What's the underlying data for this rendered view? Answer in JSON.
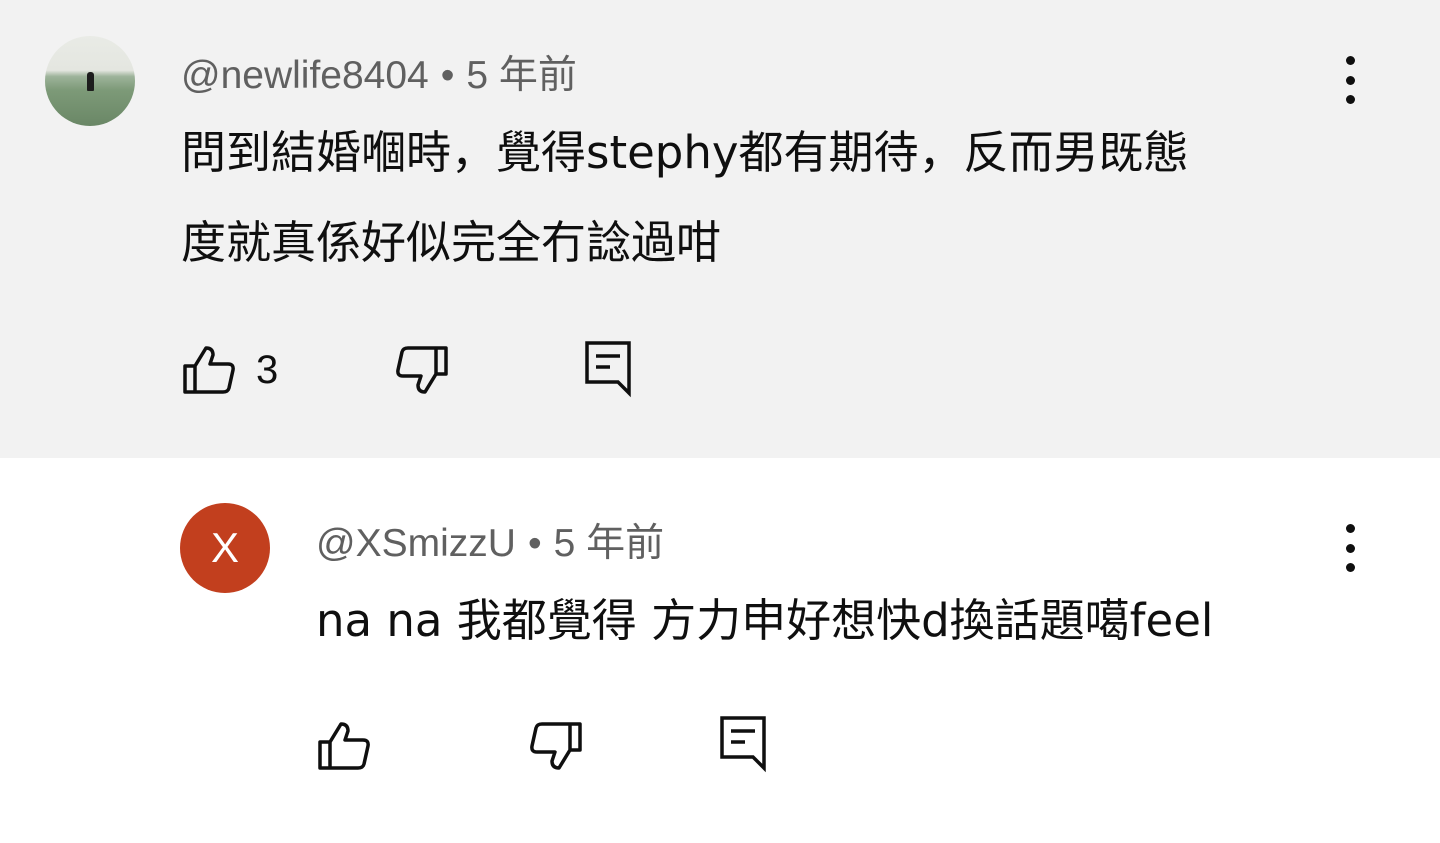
{
  "comments": [
    {
      "author": "@newlife8404",
      "separator": "•",
      "time": "5 年前",
      "lines": [
        "問到結婚嗰時，覺得stephy都有期待，反而男既態",
        "度就真係好似完全冇諗過咁"
      ],
      "like_count": "3",
      "avatar_type": "photo"
    },
    {
      "author": "@XSmizzU",
      "separator": "•",
      "time": "5 年前",
      "lines": [
        "na na 我都覺得 方力申好想快d換話題噶feel"
      ],
      "avatar_letter": "X",
      "avatar_color": "#c23f1e"
    }
  ],
  "colors": {
    "top_bg": "#f2f2f2",
    "reply_bg": "#ffffff",
    "meta_text": "#606060",
    "body_text": "#0f0f0f"
  },
  "icons": [
    "thumbs-up-icon",
    "thumbs-down-icon",
    "reply-icon",
    "more-vert-icon"
  ]
}
